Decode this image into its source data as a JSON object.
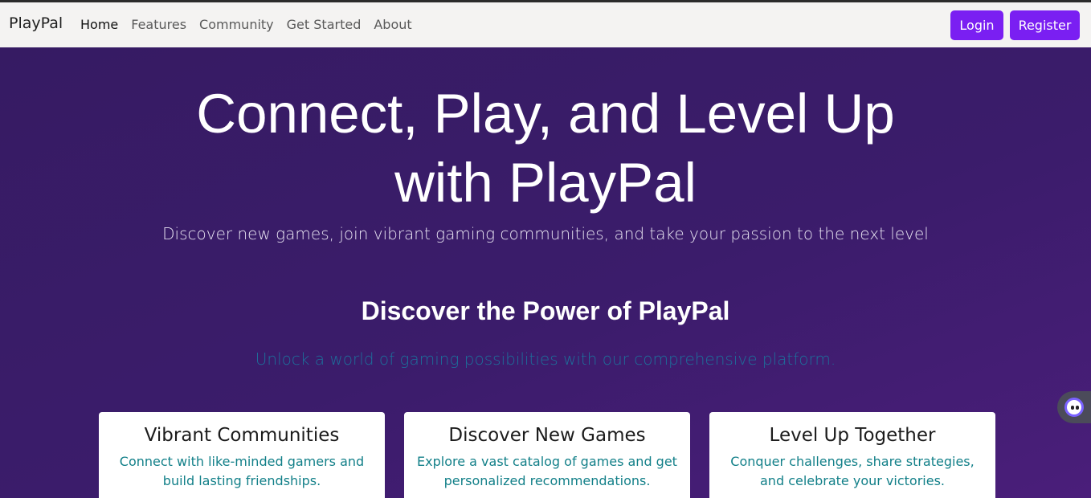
{
  "brand": "PlayPal",
  "nav": [
    {
      "label": "Home",
      "active": true
    },
    {
      "label": "Features"
    },
    {
      "label": "Community"
    },
    {
      "label": "Get Started"
    },
    {
      "label": "About"
    }
  ],
  "auth": {
    "login": "Login",
    "register": "Register"
  },
  "hero": {
    "title": "Connect, Play, and Level Up with PlayPal",
    "subtitle": "Discover new games, join vibrant gaming communities, and take your passion to the next level"
  },
  "features": {
    "title": "Discover the Power of PlayPal",
    "subtitle": "Unlock a world of gaming possibilities with our comprehensive platform.",
    "cards": [
      {
        "title": "Vibrant Communities",
        "text": "Connect with like-minded gamers and build lasting friendships."
      },
      {
        "title": "Discover New Games",
        "text": "Explore a vast catalog of games and get personalized recommendations."
      },
      {
        "title": "Level Up Together",
        "text": "Conquer challenges, share strategies, and celebrate your victories."
      }
    ]
  },
  "colors": {
    "accent": "#7a1ff2",
    "hero_bg": "#3b1c6a",
    "card_text": "#138089"
  },
  "icons": {
    "chat": "chat-bot-icon"
  }
}
